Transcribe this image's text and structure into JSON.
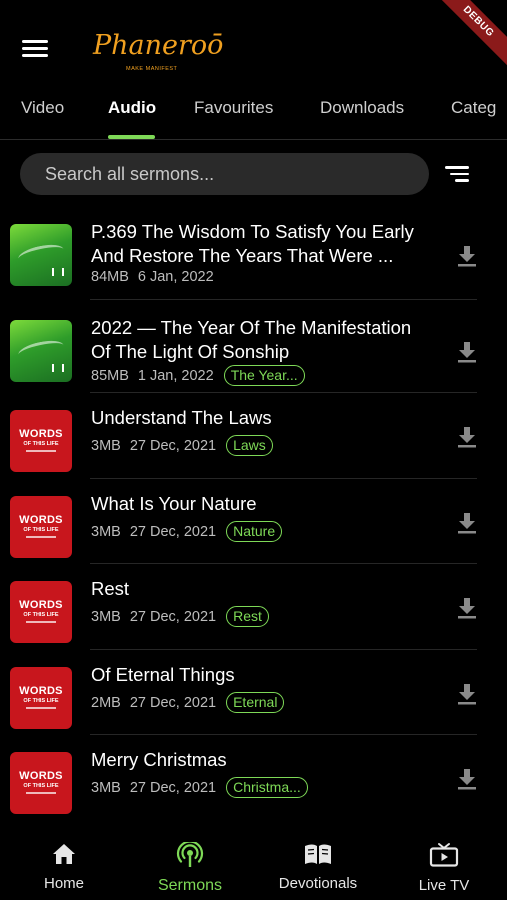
{
  "app": {
    "logo_text": "Phaneroō",
    "logo_tagline": "MAKE MANIFEST",
    "debug_label": "DEBUG"
  },
  "tabs": [
    {
      "label": "Video"
    },
    {
      "label": "Audio"
    },
    {
      "label": "Favourites"
    },
    {
      "label": "Downloads"
    },
    {
      "label": "Categ"
    }
  ],
  "active_tab": "Audio",
  "search": {
    "placeholder": "Search all sermons...",
    "value": ""
  },
  "sermons": [
    {
      "title": "P.369 The Wisdom To Satisfy You Early And Restore The Years That Were ...",
      "size": "84MB",
      "date": "6 Jan,  2022",
      "tag": "",
      "cover": "green"
    },
    {
      "title": "2022 — The Year Of The Manifestation Of The Light Of Sonship",
      "size": "85MB",
      "date": "1 Jan,  2022",
      "tag": "The Year...",
      "cover": "green"
    },
    {
      "title": "Understand The Laws",
      "size": "3MB",
      "date": "27 Dec,  2021",
      "tag": "Laws",
      "cover": "red"
    },
    {
      "title": "What Is Your Nature",
      "size": "3MB",
      "date": "27 Dec,  2021",
      "tag": "Nature",
      "cover": "red"
    },
    {
      "title": "Rest",
      "size": "3MB",
      "date": "27 Dec,  2021",
      "tag": "Rest",
      "cover": "red"
    },
    {
      "title": "Of Eternal Things",
      "size": "2MB",
      "date": "27 Dec,  2021",
      "tag": "Eternal",
      "cover": "red"
    },
    {
      "title": "Merry Christmas",
      "size": "3MB",
      "date": "27 Dec,  2021",
      "tag": "Christma...",
      "cover": "red"
    }
  ],
  "cover_text": {
    "words": "WORDS",
    "of_this_life": "OF THIS LIFE"
  },
  "bottom_nav": [
    {
      "label": "Home",
      "icon": "home-icon"
    },
    {
      "label": "Sermons",
      "icon": "podcast-icon"
    },
    {
      "label": "Devotionals",
      "icon": "book-icon"
    },
    {
      "label": "Live TV",
      "icon": "tv-icon"
    }
  ],
  "colors": {
    "accent": "#7ed957",
    "background": "#000000",
    "search_bg": "#2a2a2a",
    "cover_red": "#c8161d"
  }
}
